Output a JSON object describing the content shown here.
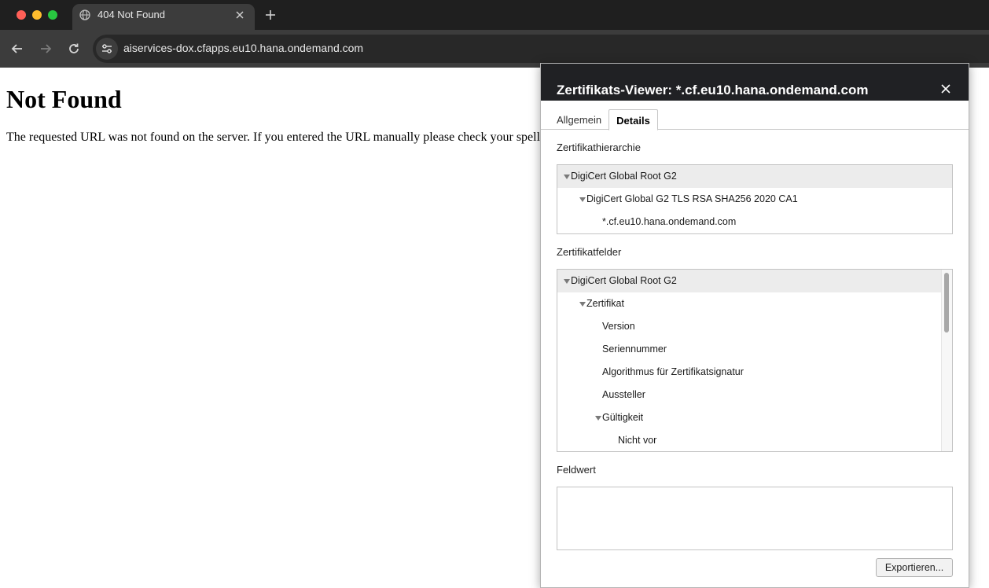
{
  "browser": {
    "tab": {
      "title": "404 Not Found",
      "icon": "globe-icon"
    },
    "address_bar": {
      "url": "aiservices-dox.cfapps.eu10.hana.ondemand.com"
    },
    "traffic_lights": {
      "close": "#ff5f57",
      "minimize": "#febc2e",
      "maximize": "#28c840"
    }
  },
  "page": {
    "heading": "Not Found",
    "text": "The requested URL was not found on the server. If you entered the URL manually please check your spell"
  },
  "dialog": {
    "title": "Zertifikats-Viewer: *.cf.eu10.hana.ondemand.com",
    "tabs": [
      {
        "label": "Allgemein",
        "active": false
      },
      {
        "label": "Details",
        "active": true
      }
    ],
    "hierarchy_label": "Zertifikathierarchie",
    "hierarchy": [
      {
        "label": "DigiCert Global Root G2",
        "level": 0,
        "expanded": true,
        "selected": true
      },
      {
        "label": "DigiCert Global G2 TLS RSA SHA256 2020 CA1",
        "level": 1,
        "expanded": true,
        "selected": false
      },
      {
        "label": "*.cf.eu10.hana.ondemand.com",
        "level": 2,
        "expanded": false,
        "selected": false
      }
    ],
    "fields_label": "Zertifikatfelder",
    "fields": [
      {
        "label": "DigiCert Global Root G2",
        "level": 0,
        "expanded": true,
        "selected": true
      },
      {
        "label": "Zertifikat",
        "level": 1,
        "expanded": true,
        "selected": false
      },
      {
        "label": "Version",
        "level": 2,
        "expanded": false,
        "selected": false
      },
      {
        "label": "Seriennummer",
        "level": 2,
        "expanded": false,
        "selected": false
      },
      {
        "label": "Algorithmus für Zertifikatsignatur",
        "level": 2,
        "expanded": false,
        "selected": false
      },
      {
        "label": "Aussteller",
        "level": 2,
        "expanded": false,
        "selected": false
      },
      {
        "label": "Gültigkeit",
        "level": 2,
        "expanded": true,
        "selected": false
      },
      {
        "label": "Nicht vor",
        "level": 3,
        "expanded": false,
        "selected": false
      }
    ],
    "value_label": "Feldwert",
    "field_value": "",
    "export_button": "Exportieren..."
  }
}
